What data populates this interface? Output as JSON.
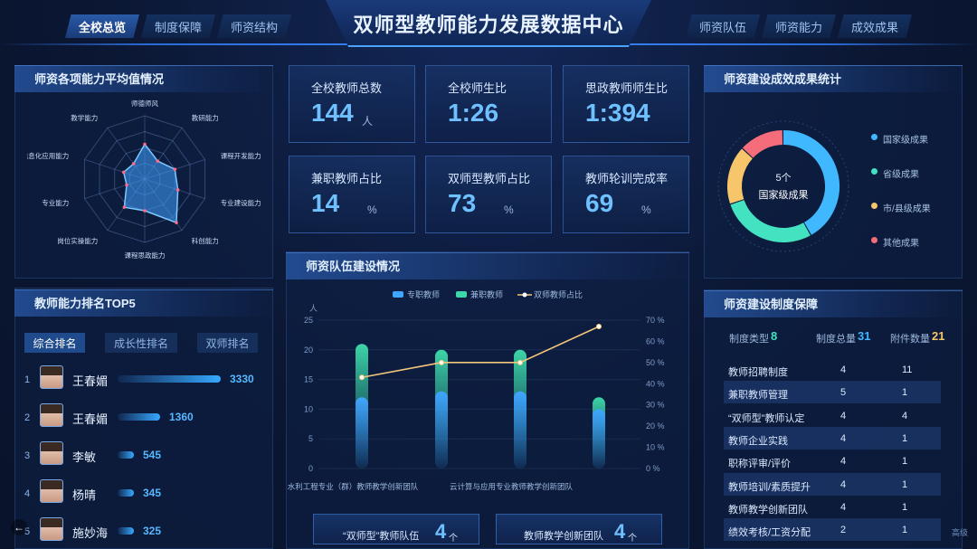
{
  "header": {
    "title": "双师型教师能力发展数据中心",
    "nav_left": [
      "全校总览",
      "制度保障",
      "师资结构"
    ],
    "nav_right": [
      "师资队伍",
      "师资能力",
      "成效成果"
    ]
  },
  "radar": {
    "title": "师资各项能力平均值情况",
    "labels": [
      "师德师风",
      "教研能力",
      "课程开发能力",
      "专业建设能力",
      "科创能力",
      "课程思政能力",
      "岗位实操能力",
      "专业能力",
      "信息化应用能力",
      "教学能力"
    ],
    "values": [
      0.55,
      0.35,
      0.5,
      0.55,
      0.85,
      0.5,
      0.55,
      0.3,
      0.35,
      0.3
    ]
  },
  "stats": [
    {
      "label": "全校教师总数",
      "value": "144",
      "unit": "人"
    },
    {
      "label": "全校师生比",
      "value": "1:26",
      "unit": ""
    },
    {
      "label": "思政教师师生比",
      "value": "1:394",
      "unit": ""
    },
    {
      "label": "兼职教师占比",
      "value": "14",
      "unit": "%"
    },
    {
      "label": "双师型教师占比",
      "value": "73",
      "unit": "%"
    },
    {
      "label": "教师轮训完成率",
      "value": "69",
      "unit": "%"
    }
  ],
  "ranking": {
    "title": "教师能力排名TOP5",
    "tabs": [
      "综合排名",
      "成长性排名",
      "双师排名"
    ],
    "items": [
      {
        "no": "1",
        "name": "王春媚",
        "value": "3330",
        "ratio": 1.0
      },
      {
        "no": "2",
        "name": "王春媚",
        "value": "1360",
        "ratio": 0.41
      },
      {
        "no": "3",
        "name": "李敏",
        "value": "545",
        "ratio": 0.16
      },
      {
        "no": "4",
        "name": "杨晴",
        "value": "345",
        "ratio": 0.1
      },
      {
        "no": "5",
        "name": "施妙海",
        "value": "325",
        "ratio": 0.1
      }
    ]
  },
  "team": {
    "title": "师资队伍建设情况",
    "legend": [
      "专职教师",
      "兼职教师",
      "双师教师占比"
    ],
    "ylabel": "人",
    "bottom_cards": [
      {
        "label": "“双师型”教师队伍",
        "value": "4",
        "unit": "个"
      },
      {
        "label": "教师教学创新团队",
        "value": "4",
        "unit": "个"
      }
    ]
  },
  "chart_data": {
    "type": "bar",
    "categories": [
      "水利工程专业（群）教师教学创新团队",
      "",
      "云计算与应用专业教师教学创新团队",
      ""
    ],
    "series": [
      {
        "name": "专职教师",
        "values": [
          12,
          13,
          13,
          10
        ]
      },
      {
        "name": "兼职教师",
        "values": [
          21,
          20,
          20,
          12
        ]
      },
      {
        "name": "双师教师占比",
        "values": [
          43,
          50,
          50,
          67
        ]
      }
    ],
    "ylabel": "人",
    "ylim": [
      0,
      25
    ],
    "y2lim": [
      0,
      70
    ],
    "yticks": [
      "25",
      "20",
      "15",
      "10",
      "5",
      "0"
    ],
    "y2ticks": [
      "70 %",
      "60 %",
      "50 %",
      "40 %",
      "30 %",
      "20 %",
      "10 %",
      "0 %"
    ]
  },
  "donut": {
    "title": "师资建设成效成果统计",
    "center_value": "5个",
    "center_label": "国家级成果",
    "items": [
      {
        "label": "国家级成果",
        "color": "#3fb8ff",
        "ratio": 0.42
      },
      {
        "label": "省级成果",
        "color": "#43e3c1",
        "ratio": 0.28
      },
      {
        "label": "市/县级成果",
        "color": "#f7c66a",
        "ratio": 0.17
      },
      {
        "label": "其他成果",
        "color": "#f56c7a",
        "ratio": 0.13
      }
    ]
  },
  "system": {
    "title": "师资建设制度保障",
    "summary": [
      {
        "label": "制度类型",
        "value": "8",
        "color": "#43e3c1"
      },
      {
        "label": "制度总量",
        "value": "31",
        "color": "#3fb8ff"
      },
      {
        "label": "附件数量",
        "value": "21",
        "color": "#f7c66a"
      }
    ],
    "rows": [
      [
        "教师招聘制度",
        "4",
        "11"
      ],
      [
        "兼职教师管理",
        "5",
        "1"
      ],
      [
        "“双师型”教师认定",
        "4",
        "4"
      ],
      [
        "教师企业实践",
        "4",
        "1"
      ],
      [
        "职称评审/评价",
        "4",
        "1"
      ],
      [
        "教师培训/素质提升",
        "4",
        "1"
      ],
      [
        "教师教学创新团队",
        "4",
        "1"
      ],
      [
        "绩效考核/工资分配",
        "2",
        "1"
      ]
    ]
  },
  "misc": {
    "back_arrow": "←",
    "bottom_right": "高级"
  }
}
